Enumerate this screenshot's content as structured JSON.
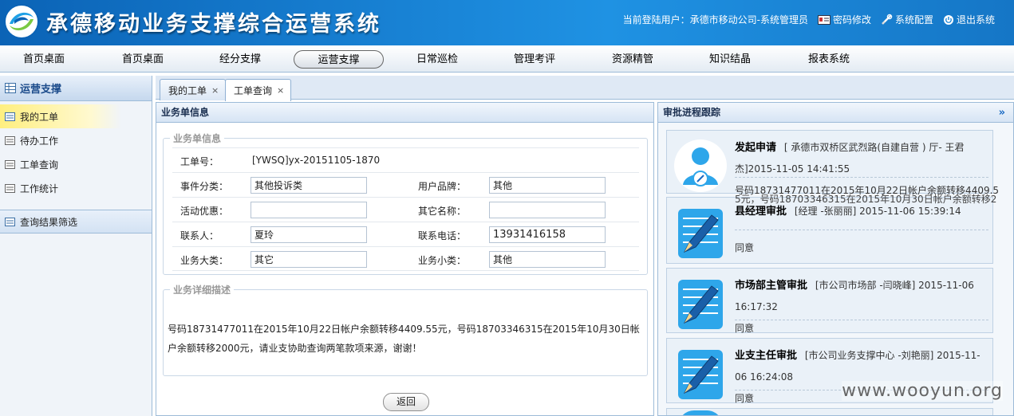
{
  "header": {
    "brand": "承德移动业务支撑综合运营系统",
    "user_text": "当前登陆用户：承德市移动公司-系统管理员",
    "pwd_link": "密码修改",
    "config_link": "系统配置",
    "logout_link": "退出系统"
  },
  "menu": {
    "items": [
      "首页桌面",
      "首页桌面",
      "经分支撑",
      "运营支撑",
      "日常巡检",
      "管理考评",
      "资源精管",
      "知识结晶",
      "报表系统"
    ],
    "active": "运营支撑"
  },
  "sidebar": {
    "title": "运营支撑",
    "items": [
      "我的工单",
      "待办工作",
      "工单查询",
      "工作统计"
    ],
    "selected": "我的工单",
    "filter": "查询结果筛选"
  },
  "tabs": [
    {
      "label": "我的工单",
      "close": "×"
    },
    {
      "label": "工单查询",
      "close": "×"
    }
  ],
  "form": {
    "panel_title": "业务单信息",
    "section_title": "业务单信息",
    "order_no_label": "工单号：",
    "order_no": "[YWSQ]yx-20151105-1870",
    "event_type_label": "事件分类：",
    "event_type": "其他投诉类",
    "brand_label": "用户品牌：",
    "brand_value": "其他",
    "promo_label": "活动优惠：",
    "promo_value": "",
    "other_label": "其它名称：",
    "other_value": "",
    "contact_label": "联系人：",
    "contact": "夏玲",
    "phone_label": "联系电话：",
    "phone": "13931416158",
    "major_label": "业务大类：",
    "major": "其它",
    "minor_label": "业务小类：",
    "minor": "其他",
    "desc_title": "业务详细描述",
    "desc": "号码18731477011在2015年10月22日帐户余额转移4409.55元，号码18703346315在2015年10月30日帐户余额转移2000元，请业支协助查询两笔款项来源，谢谢！",
    "back_button": "返回"
  },
  "approval": {
    "panel_title": "审批进程跟踪",
    "steps": [
      {
        "title": "发起申请",
        "detail": "[ 承德市双桥区武烈路(自建自营 ) 厅- 王君杰]2015-11-05 14:41:55",
        "result": "号码18731477011在2015年10月22日帐户余额转移4409.5",
        "overflow": "5元，号码18703346315在2015年10月30日帐户余额转移2"
      },
      {
        "title": "县经理审批",
        "detail": "[经理 -张丽丽] 2015-11-06 15:39:14",
        "result": "同意"
      },
      {
        "title": "市场部主管审批",
        "detail": "[市公司市场部 -闫晓峰] 2015-11-06 16:17:32",
        "result": "同意"
      },
      {
        "title": "业支主任审批",
        "detail": "[市公司业务支撑中心 -刘艳丽] 2015-11-06 16:24:08",
        "result": "同意"
      }
    ]
  },
  "watermark": "www.wooyun.org",
  "colors": {
    "header_blue": "#1a86d8",
    "border_blue": "#9dbbd8",
    "accent_blue": "#1f9be8"
  }
}
